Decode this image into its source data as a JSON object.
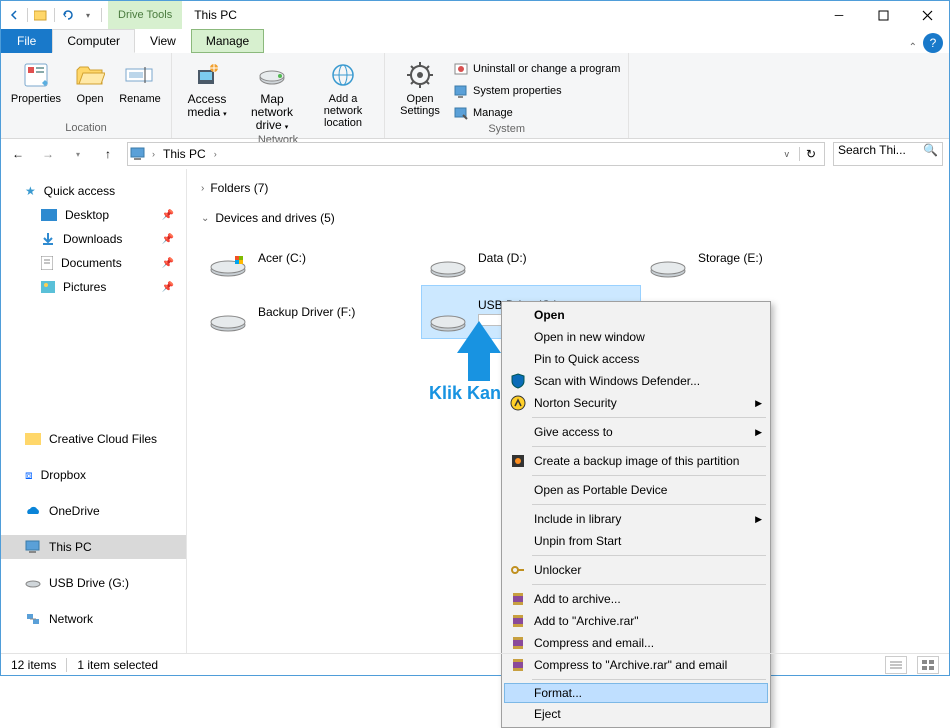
{
  "title": "This PC",
  "drivetools": "Drive Tools",
  "tabs": {
    "file": "File",
    "computer": "Computer",
    "view": "View",
    "manage": "Manage"
  },
  "ribbon": {
    "properties": "Properties",
    "open": "Open",
    "rename": "Rename",
    "access": "Access media",
    "mapdrive": "Map network drive",
    "addnet": "Add a network location",
    "opensettings": "Open Settings",
    "uninstall": "Uninstall or change a program",
    "sysprops": "System properties",
    "manage": "Manage",
    "g_location": "Location",
    "g_network": "Network",
    "g_system": "System"
  },
  "addr": {
    "thispc": "This PC",
    "search_ph": "Search Thi..."
  },
  "side": {
    "quick": "Quick access",
    "desktop": "Desktop",
    "downloads": "Downloads",
    "documents": "Documents",
    "pictures": "Pictures",
    "creative": "Creative Cloud Files",
    "dropbox": "Dropbox",
    "onedrive": "OneDrive",
    "thispc": "This PC",
    "usb": "USB Drive (G:)",
    "network": "Network"
  },
  "sections": {
    "folders": "Folders (7)",
    "devices": "Devices and drives (5)"
  },
  "drives": {
    "acer": "Acer (C:)",
    "data": "Data (D:)",
    "storage": "Storage (E:)",
    "backup": "Backup Driver (F:)",
    "usb": "USB Drive (G:)"
  },
  "annotation": "Klik Kanan",
  "menu": {
    "open": "Open",
    "openwin": "Open in new window",
    "pin": "Pin to Quick access",
    "defender": "Scan with Windows Defender...",
    "norton": "Norton Security",
    "access": "Give access to",
    "backup": "Create a backup image of this partition",
    "portable": "Open as Portable Device",
    "library": "Include in library",
    "unpin": "Unpin from Start",
    "unlocker": "Unlocker",
    "addarch": "Add to archive...",
    "addrar": "Add to \"Archive.rar\"",
    "compemail": "Compress and email...",
    "comprar": "Compress to \"Archive.rar\" and email",
    "format": "Format...",
    "eject": "Eject"
  },
  "status": {
    "items": "12 items",
    "selected": "1 item selected"
  }
}
